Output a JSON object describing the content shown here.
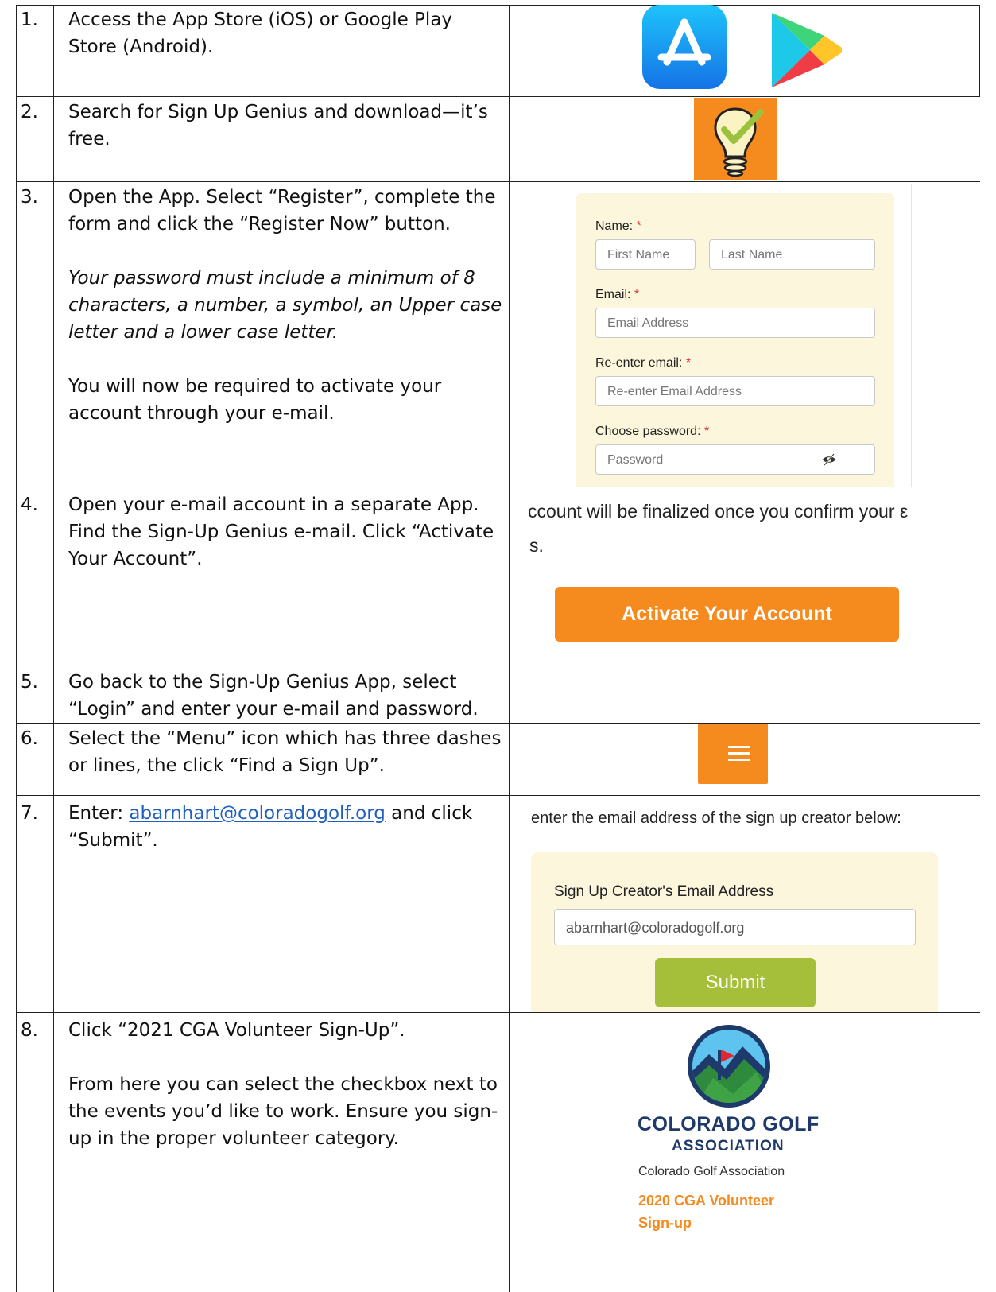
{
  "steps": [
    {
      "num": "1.",
      "lines": [
        "Access the App Store (iOS) or Google Play",
        "Store (Android)."
      ]
    },
    {
      "num": "2.",
      "lines": [
        "Search for Sign Up Genius and download—it’s",
        "free."
      ]
    },
    {
      "num": "3.",
      "lines": [
        "Open the App. Select “Register”, complete the",
        "form and click the “Register Now” button."
      ],
      "note": [
        "Your password must include a minimum of 8",
        "characters, a number, a symbol, an Upper case",
        "letter and a lower case letter."
      ],
      "extra": [
        "You will now be required to activate your",
        "account through your e-mail."
      ]
    },
    {
      "num": "4.",
      "lines": [
        "Open your e-mail account in a separate App.",
        "Find the Sign-Up Genius e-mail. Click “Activate",
        "Your Account”."
      ]
    },
    {
      "num": "5.",
      "lines": [
        "Go back to the Sign-Up Genius App, select",
        "“Login” and enter your e-mail and password."
      ]
    },
    {
      "num": "6.",
      "lines": [
        "Select the “Menu” icon which has three dashes",
        "or lines, the click “Find a Sign Up”."
      ]
    },
    {
      "num": "7.",
      "prefix": "Enter: ",
      "email": "abarnhart@coloradogolf.org",
      "suffix": " and click",
      "line2": "“Submit”."
    },
    {
      "num": "8.",
      "lines": [
        "Click “2021 CGA Volunteer Sign-Up”."
      ],
      "extra": [
        "From here you can select the checkbox next to",
        "the events you’d like to work. Ensure you sign-",
        "up in the proper volunteer category."
      ]
    }
  ],
  "register_form": {
    "name_label": "Name:",
    "first_name_placeholder": "First Name",
    "last_name_placeholder": "Last Name",
    "email_label": "Email:",
    "email_placeholder": "Email Address",
    "reenter_label": "Re-enter email:",
    "reenter_placeholder": "Re-enter Email Address",
    "password_label": "Choose password:",
    "password_placeholder": "Password",
    "required_mark": "*"
  },
  "activation": {
    "text_line1": "ccount will be finalized once you confirm your ε",
    "text_line2": "s.",
    "button_label": "Activate Your Account"
  },
  "find_signup": {
    "instruction": "enter the email address of the sign up creator below:",
    "field_label": "Sign Up Creator's Email Address",
    "field_value": "abarnhart@coloradogolf.org",
    "submit_label": "Submit"
  },
  "cga": {
    "logo_line1": "COLORADO GOLF",
    "logo_line2": "ASSOCIATION",
    "org_name": "Colorado Golf Association",
    "signup_title_line1": "2020 CGA Volunteer",
    "signup_title_line2": "Sign-up"
  },
  "colors": {
    "orange": "#f58a1f",
    "submit_green": "#a6bf3a",
    "panel_cream": "#fcf6dc",
    "link_blue": "#1f5fbf"
  }
}
